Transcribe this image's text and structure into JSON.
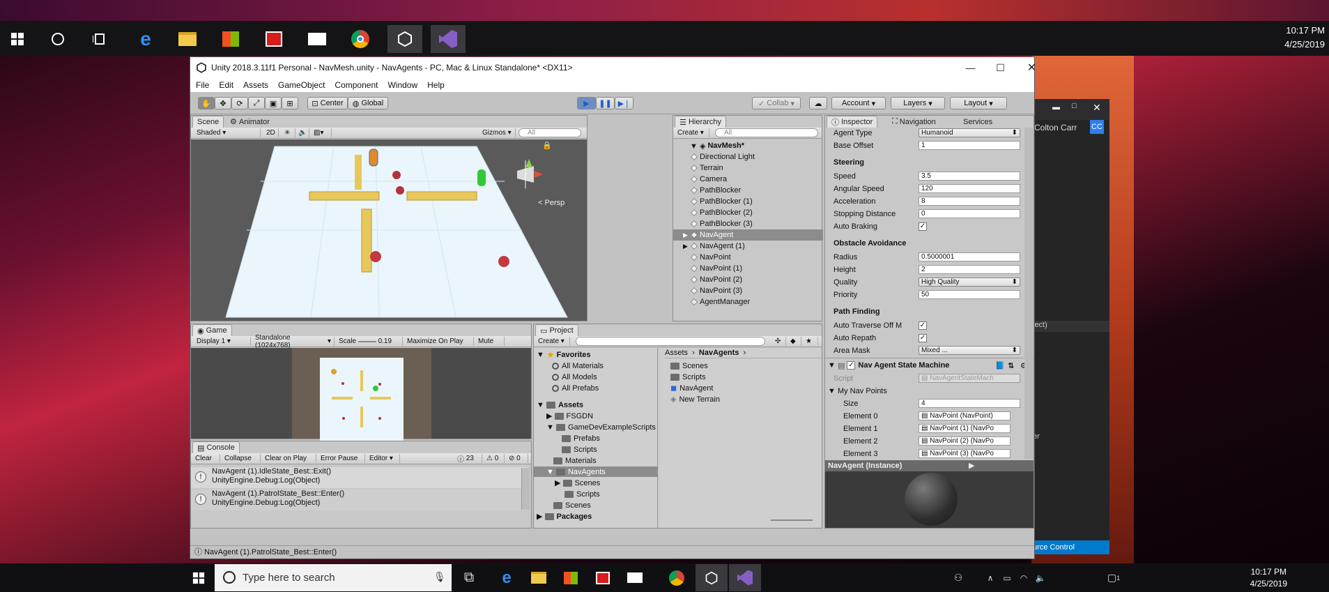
{
  "taskbar_top": {
    "time": "10:17 PM",
    "date": "4/25/2019",
    "apps": [
      "start-icon",
      "cortana-icon",
      "task-view-icon",
      "edge-icon",
      "file-explorer-icon",
      "store-icon",
      "gift-icon",
      "mail-icon",
      "chrome-icon",
      "unity-icon",
      "visual-studio-icon"
    ]
  },
  "taskbar_bottom": {
    "search_placeholder": "Type here to search",
    "time": "10:17 PM",
    "date": "4/25/2019",
    "notification_count": "1"
  },
  "vs_window": {
    "user": "Colton Carr",
    "initials": "CC",
    "text1": "ject)",
    "text2": "er",
    "source_control": "urce Control"
  },
  "unity": {
    "title": "Unity 2018.3.11f1 Personal - NavMesh.unity - NavAgents - PC, Mac & Linux Standalone* <DX11>",
    "menu": [
      "File",
      "Edit",
      "Assets",
      "GameObject",
      "Component",
      "Window",
      "Help"
    ],
    "toolbar": {
      "center": "Center",
      "global": "Global",
      "collab": "Collab",
      "account": "Account",
      "layers": "Layers",
      "layout": "Layout"
    },
    "scene": {
      "tab_scene": "Scene",
      "tab_animator": "Animator",
      "shading": "Shaded",
      "mode_2d": "2D",
      "gizmos": "Gizmos",
      "search": "All",
      "persp": "Persp"
    },
    "game": {
      "tab": "Game",
      "display": "Display 1",
      "resolution": "Standalone (1024x768)",
      "scale_label": "Scale",
      "scale_value": "0.19",
      "maximize": "Maximize On Play",
      "mute": "Mute"
    },
    "console": {
      "tab": "Console",
      "clear": "Clear",
      "collapse": "Collapse",
      "clear_on_play": "Clear on Play",
      "error_pause": "Error Pause",
      "editor": "Editor",
      "count_info": "23",
      "count_warn": "0",
      "count_err": "0",
      "entries": [
        {
          "line1": "NavAgent (1).IdleState_Best::Exit()",
          "line2": "UnityEngine.Debug:Log(Object)"
        },
        {
          "line1": "NavAgent (1).PatrolState_Best::Enter()",
          "line2": "UnityEngine.Debug:Log(Object)"
        }
      ],
      "status": "NavAgent (1).PatrolState_Best::Enter()"
    },
    "hierarchy": {
      "tab": "Hierarchy",
      "create": "Create",
      "search": "All",
      "root": "NavMesh*",
      "items": [
        "Directional Light",
        "Terrain",
        "Camera",
        "PathBlocker",
        "PathBlocker (1)",
        "PathBlocker (2)",
        "PathBlocker (3)",
        "NavAgent",
        "NavAgent (1)",
        "NavPoint",
        "NavPoint (1)",
        "NavPoint (2)",
        "NavPoint (3)",
        "AgentManager"
      ]
    },
    "project": {
      "tab": "Project",
      "create": "Create",
      "favorites": "Favorites",
      "fav_items": [
        "All Materials",
        "All Models",
        "All Prefabs"
      ],
      "assets": "Assets",
      "tree": [
        "FSGDN",
        "GameDevExampleScripts",
        "Prefabs",
        "Scripts",
        "Materials",
        "NavAgents",
        "Scenes",
        "Scripts",
        "Scenes"
      ],
      "packages": "Packages",
      "breadcrumb_root": "Assets",
      "breadcrumb_leaf": "NavAgents",
      "files": [
        "Scenes",
        "Scripts",
        "NavAgent",
        "New Terrain"
      ]
    },
    "inspector": {
      "tab": "Inspector",
      "tab_nav": "Navigation",
      "tab_services": "Services",
      "agent_type_label": "Agent Type",
      "agent_type": "Humanoid",
      "base_offset_label": "Base Offset",
      "base_offset": "1",
      "steering": "Steering",
      "speed_label": "Speed",
      "speed": "3.5",
      "angular_speed_label": "Angular Speed",
      "angular_speed": "120",
      "acceleration_label": "Acceleration",
      "acceleration": "8",
      "stopping_label": "Stopping Distance",
      "stopping": "0",
      "auto_braking_label": "Auto Braking",
      "obstacle": "Obstacle Avoidance",
      "radius_label": "Radius",
      "radius": "0.5000001",
      "height_label": "Height",
      "height": "2",
      "quality_label": "Quality",
      "quality": "High Quality",
      "priority_label": "Priority",
      "priority": "50",
      "path_finding": "Path Finding",
      "auto_traverse_label": "Auto Traverse Off M",
      "auto_repath_label": "Auto Repath",
      "area_mask_label": "Area Mask",
      "area_mask": "Mixed ...",
      "component": "Nav Agent State Machine",
      "script_label": "Script",
      "script": "NavAgentStateMach",
      "my_nav_points": "My Nav Points",
      "size_label": "Size",
      "size": "4",
      "elements": [
        {
          "label": "Element 0",
          "value": "NavPoint (NavPoint)"
        },
        {
          "label": "Element 1",
          "value": "NavPoint (1) (NavPo"
        },
        {
          "label": "Element 2",
          "value": "NavPoint (2) (NavPo"
        },
        {
          "label": "Element 3",
          "value": "NavPoint (3) (NavPo"
        }
      ],
      "preview_title": "NavAgent (Instance)"
    }
  }
}
